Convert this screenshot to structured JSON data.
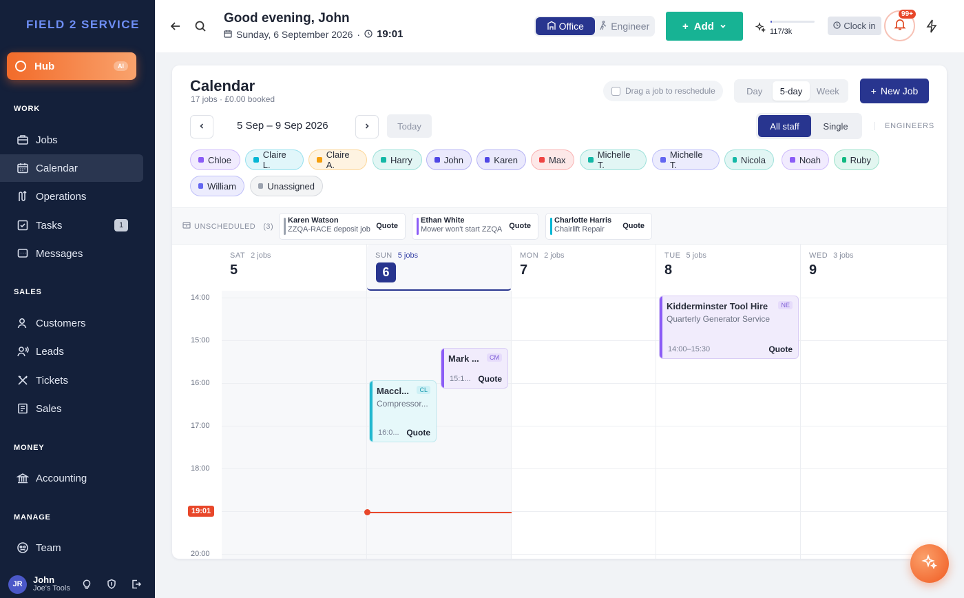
{
  "brand": {
    "logo": "FIELD 2 SERVICE"
  },
  "sidebar": {
    "hub": {
      "label": "Hub",
      "badge": "AI"
    },
    "sections": {
      "work": "WORK",
      "sales": "SALES",
      "money": "MONEY",
      "manage": "MANAGE"
    },
    "items": {
      "jobs": "Jobs",
      "calendar": "Calendar",
      "operations": "Operations",
      "tasks": "Tasks",
      "tasks_badge": "1",
      "messages": "Messages",
      "customers": "Customers",
      "leads": "Leads",
      "tickets": "Tickets",
      "sales": "Sales",
      "accounting": "Accounting",
      "team": "Team"
    },
    "user": {
      "initials": "JR",
      "name": "John",
      "company": "Joe's Tools"
    }
  },
  "header": {
    "greeting": "Good evening, John",
    "date": "Sunday, 6 September 2026",
    "time": "19:01",
    "mode": {
      "office": "Office",
      "engineer": "Engineer",
      "selected": "Office"
    },
    "add_label": "Add",
    "credits": {
      "text": "117/3k",
      "fraction": 0.039
    },
    "clock_in": "Clock in",
    "notifications": "99+"
  },
  "calendar": {
    "title": "Calendar",
    "subtitle": "17 jobs · £0.00 booked",
    "drag_hint": "Drag a job to reschedule",
    "views": {
      "day": "Day",
      "five_day": "5-day",
      "week": "Week",
      "selected": "5-day"
    },
    "new_job": "New Job",
    "range": "5 Sep – 9 Sep 2026",
    "today": "Today",
    "staff": {
      "all": "All staff",
      "single": "Single",
      "selected": "All staff"
    },
    "engineers_label": "ENGINEERS",
    "staff_chips": [
      {
        "name": "Chloe",
        "color": "#8b5cf6"
      },
      {
        "name": "Claire L.",
        "color": "#06b6d4"
      },
      {
        "name": "Claire A.",
        "color": "#f59e0b"
      },
      {
        "name": "Harry",
        "color": "#14b8a6"
      },
      {
        "name": "John",
        "color": "#4f46e5"
      },
      {
        "name": "Karen",
        "color": "#4f46e5"
      },
      {
        "name": "Max",
        "color": "#ef4444"
      },
      {
        "name": "Michelle T.",
        "color": "#14b8a6"
      },
      {
        "name": "Michelle T.",
        "color": "#6366f1"
      },
      {
        "name": "Nicola",
        "color": "#14b8a6"
      },
      {
        "name": "Noah",
        "color": "#8b5cf6"
      },
      {
        "name": "Ruby",
        "color": "#10b981"
      },
      {
        "name": "William",
        "color": "#6366f1"
      },
      {
        "name": "Unassigned",
        "color": "#9ca3af"
      }
    ],
    "unscheduled": {
      "label": "UNSCHEDULED",
      "count": "(3)",
      "items": [
        {
          "customer": "Karen Watson",
          "desc": "ZZQA-RACE deposit job",
          "type": "Quote",
          "color": "#9ca3af"
        },
        {
          "customer": "Ethan White",
          "desc": "Mower won't start ZZQA",
          "type": "Quote",
          "color": "#8b5cf6"
        },
        {
          "customer": "Charlotte Harris",
          "desc": "Chairlift Repair",
          "type": "Quote",
          "color": "#06b6d4"
        }
      ]
    },
    "days": [
      {
        "dow": "SAT",
        "num": "5",
        "jobs": "2 jobs"
      },
      {
        "dow": "SUN",
        "num": "6",
        "jobs": "5 jobs",
        "today": true
      },
      {
        "dow": "MON",
        "num": "7",
        "jobs": "2 jobs"
      },
      {
        "dow": "TUE",
        "num": "8",
        "jobs": "5 jobs"
      },
      {
        "dow": "WED",
        "num": "9",
        "jobs": "3 jobs"
      }
    ],
    "hours": [
      "14:00",
      "15:00",
      "16:00",
      "17:00",
      "18:00",
      "20:00"
    ],
    "now_label": "19:01",
    "events": [
      {
        "title": "Kidderminster Tool Hire",
        "desc": "Quarterly Generator Service",
        "tag": "NE",
        "time": "14:00–15:30",
        "type": "Quote",
        "theme": "purple"
      },
      {
        "title": "Mark ...",
        "desc": "",
        "tag": "CM",
        "time": "15:1...",
        "type": "Quote",
        "theme": "purple"
      },
      {
        "title": "Maccl...",
        "desc": "Compressor...",
        "tag": "CL",
        "time": "16:0...",
        "type": "Quote",
        "theme": "cyan"
      }
    ]
  }
}
